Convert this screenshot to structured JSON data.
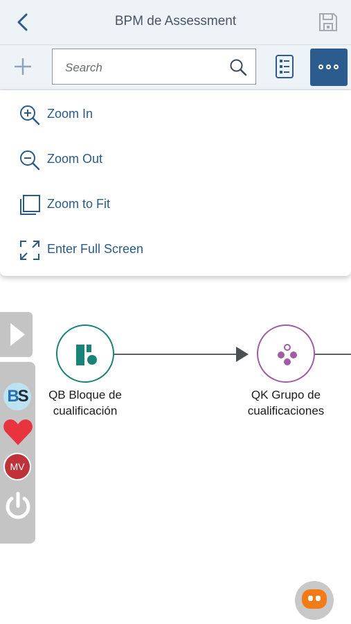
{
  "header": {
    "title": "BPM de Assessment",
    "back_icon": "chevron-left-icon",
    "save_icon": "save-icon"
  },
  "toolbar": {
    "add_icon": "plus-icon",
    "search": {
      "placeholder": "Search",
      "value": ""
    },
    "list_icon": "list-icon",
    "more_icon": "more-horizontal-icon"
  },
  "menu": {
    "items": [
      {
        "label": "Zoom In",
        "icon": "zoom-in-icon"
      },
      {
        "label": "Zoom Out",
        "icon": "zoom-out-icon"
      },
      {
        "label": "Zoom to Fit",
        "icon": "zoom-to-fit-icon"
      },
      {
        "label": "Enter Full Screen",
        "icon": "full-screen-icon"
      }
    ]
  },
  "side_panel": {
    "badge_b": "B",
    "badge_s": "S",
    "avatar_initials": "MV"
  },
  "diagram": {
    "nodes": [
      {
        "line1": "QB Bloque de",
        "line2": "cualificación",
        "color": "#1a8377"
      },
      {
        "line1": "QK Grupo de",
        "line2": "cualificaciones",
        "color": "#a25ca5"
      }
    ]
  },
  "colors": {
    "accent": "#2c5c8d",
    "link_text": "#2a5a87",
    "header_bg": "#eef3f8"
  }
}
